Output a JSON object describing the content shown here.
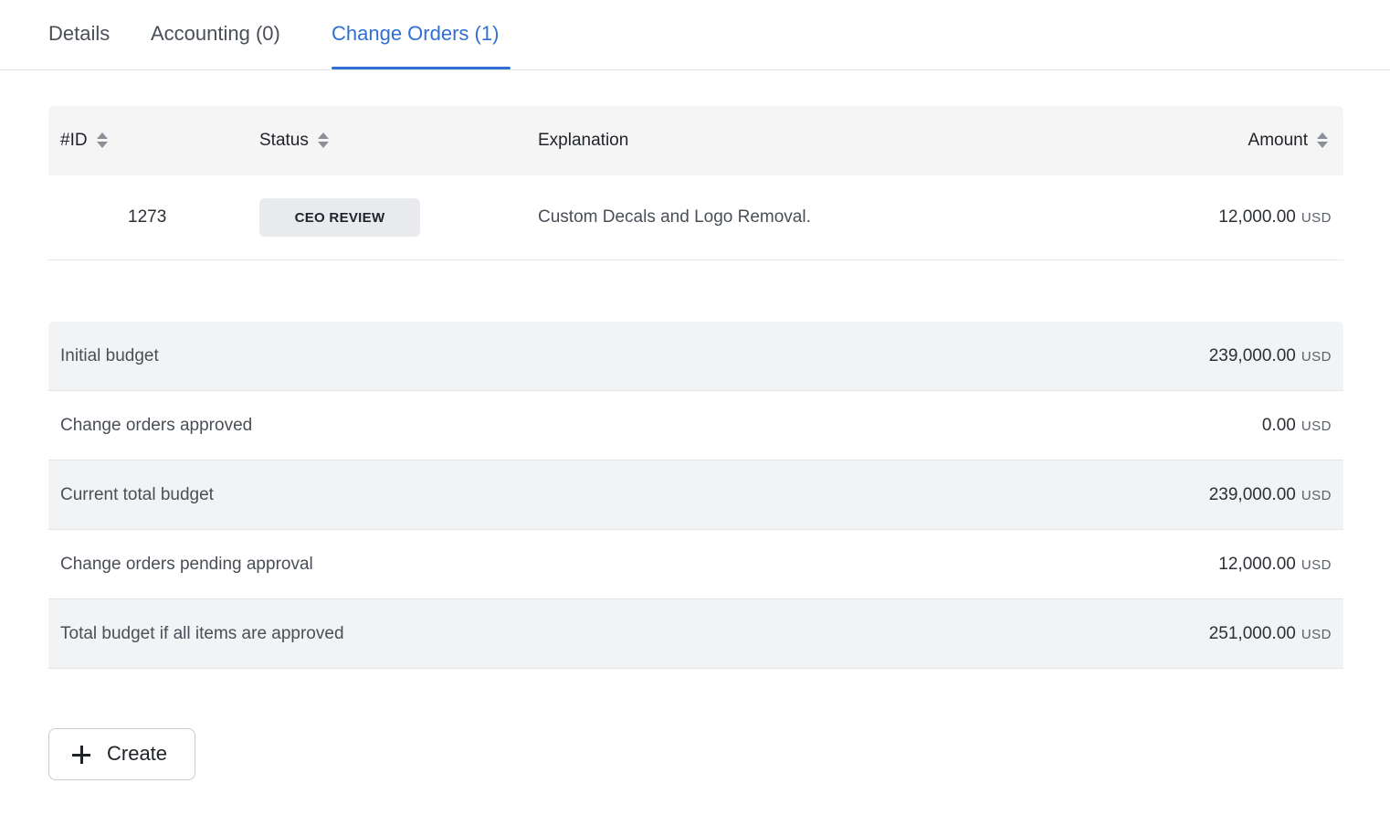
{
  "tabs": [
    {
      "label": "Details",
      "active": false
    },
    {
      "label": "Accounting (0)",
      "active": false
    },
    {
      "label": "Change Orders (1)",
      "active": true
    }
  ],
  "change_orders": {
    "columns": {
      "id": "#ID",
      "status": "Status",
      "explanation": "Explanation",
      "amount": "Amount"
    },
    "rows": [
      {
        "id": "1273",
        "status": "CEO REVIEW",
        "explanation": "Custom Decals and Logo Removal.",
        "amount": "12,000.00",
        "currency": "USD"
      }
    ]
  },
  "summary": [
    {
      "label": "Initial budget",
      "amount": "239,000.00",
      "currency": "USD"
    },
    {
      "label": "Change orders approved",
      "amount": "0.00",
      "currency": "USD"
    },
    {
      "label": "Current total budget",
      "amount": "239,000.00",
      "currency": "USD"
    },
    {
      "label": "Change orders pending approval",
      "amount": "12,000.00",
      "currency": "USD"
    },
    {
      "label": "Total budget if all items are approved",
      "amount": "251,000.00",
      "currency": "USD"
    }
  ],
  "create_button": {
    "label": "Create"
  },
  "colors": {
    "accent": "#2f6fd6",
    "header_bg": "#f5f5f6",
    "shaded_row": "#f2f3f5",
    "badge_bg": "#e8eaee"
  }
}
